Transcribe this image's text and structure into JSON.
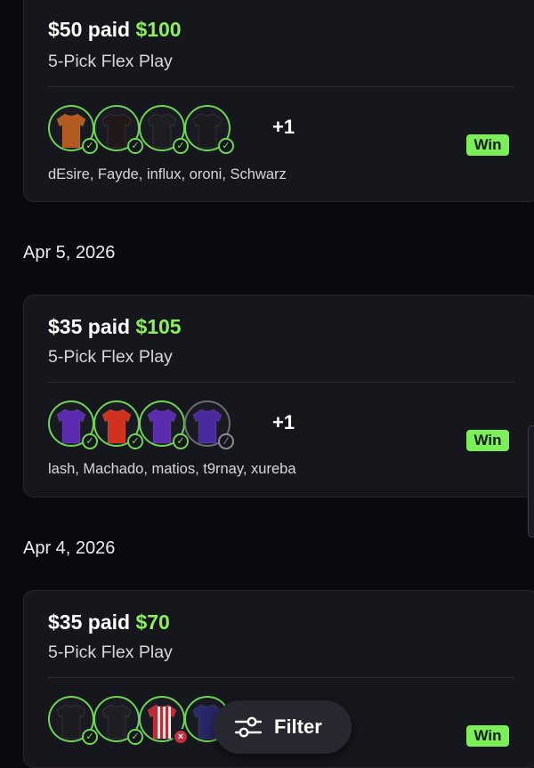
{
  "colors": {
    "background": "#09090f",
    "card": "#16161d",
    "payout_green": "#8bf05b",
    "win_badge": "#7cee58",
    "check_green": "#6fd455",
    "lost_red": "#c43040"
  },
  "entries": [
    {
      "paid_label": "$50 paid",
      "payout": "$100",
      "play_type": "5-Pick Flex Play",
      "extra_count": "+1",
      "players": "dEsire, Fayde, influx, oroni, Schwarz",
      "result": "Win",
      "picks": [
        {
          "jersey": "orange-jersey",
          "color": "#b25a1f",
          "status": "won",
          "status_icon": "check-icon"
        },
        {
          "jersey": "black-red-jersey",
          "color": "#22181a",
          "status": "won",
          "status_icon": "check-icon"
        },
        {
          "jersey": "black-jersey",
          "color": "#1e1e22",
          "status": "won",
          "status_icon": "check-icon"
        },
        {
          "jersey": "black-jersey",
          "color": "#1b1b1f",
          "status": "won",
          "status_icon": "check-icon"
        }
      ]
    },
    {
      "date": "Apr 5, 2026",
      "paid_label": "$35 paid",
      "payout": "$105",
      "play_type": "5-Pick Flex Play",
      "extra_count": "+1",
      "players": "lash, Machado, matios, t9rnay, xureba",
      "result": "Win",
      "picks": [
        {
          "jersey": "purple-jersey",
          "color": "#5b2bb0",
          "status": "won",
          "status_icon": "check-icon"
        },
        {
          "jersey": "red-jersey",
          "color": "#d0321f",
          "status": "won",
          "status_icon": "check-icon"
        },
        {
          "jersey": "purple-jersey",
          "color": "#5b2bb0",
          "status": "won",
          "status_icon": "check-icon"
        },
        {
          "jersey": "purple-jersey",
          "color": "#4b2aa0",
          "status": "pending",
          "status_icon": "slash-icon"
        }
      ]
    },
    {
      "date": "Apr 4, 2026",
      "paid_label": "$35 paid",
      "payout": "$70",
      "play_type": "5-Pick Flex Play",
      "result": "Win",
      "picks": [
        {
          "jersey": "black-jersey",
          "color": "#1d1d21",
          "status": "won",
          "status_icon": "check-icon"
        },
        {
          "jersey": "black-jersey",
          "color": "#1f1f23",
          "status": "won",
          "status_icon": "check-icon"
        },
        {
          "jersey": "red-white-striped-jersey",
          "color": "#c02a33",
          "status": "lost",
          "status_icon": "x-icon"
        },
        {
          "jersey": "navy-jersey",
          "color": "#28286a",
          "status": "won",
          "status_icon": "check-icon"
        }
      ]
    }
  ],
  "filter": {
    "label": "Filter",
    "icon": "sliders-icon"
  }
}
